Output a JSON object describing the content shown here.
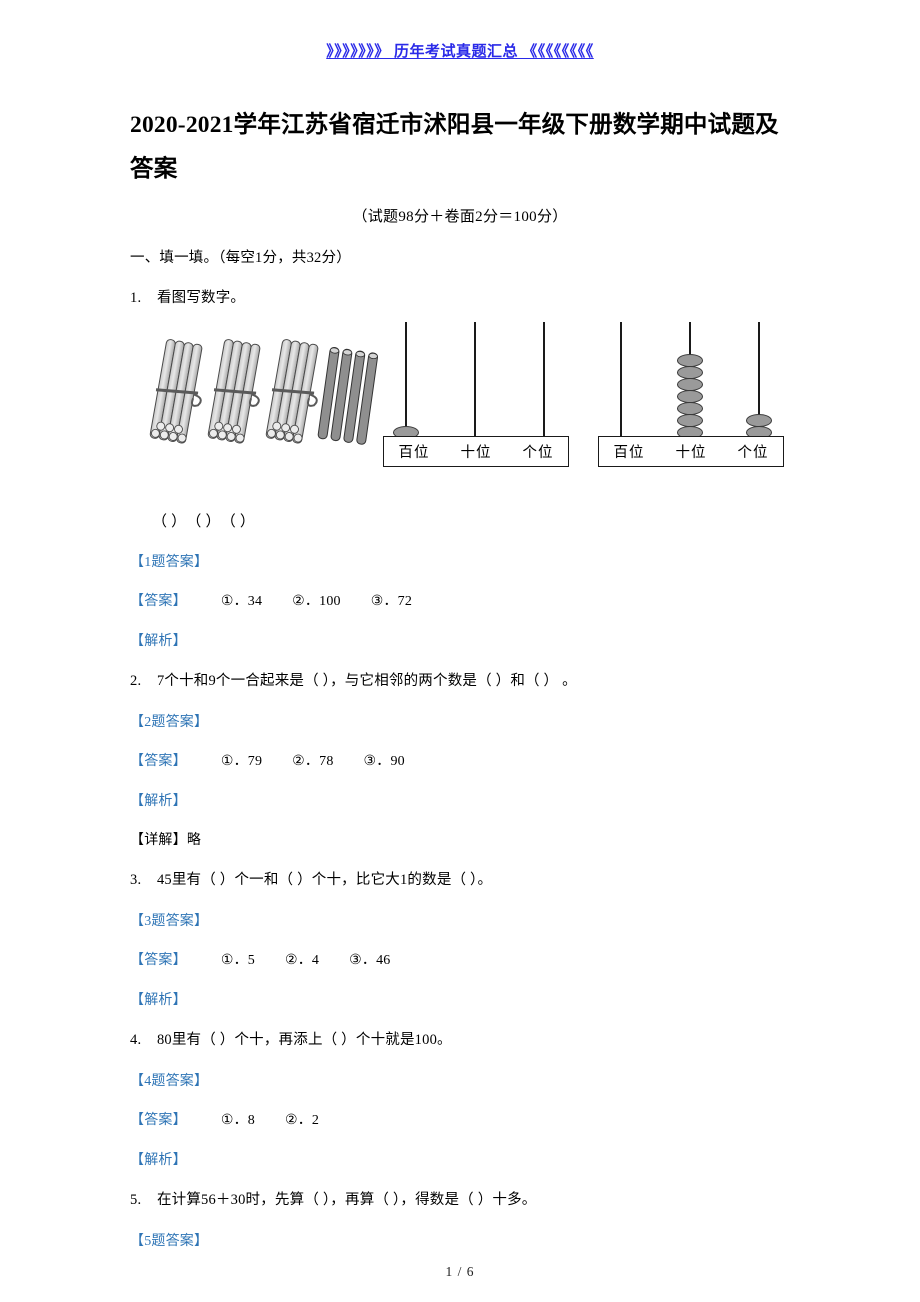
{
  "header": {
    "banner_text": "》》》》》》》 历年考试真题汇总 《《《《《《《《"
  },
  "document": {
    "title": "2020-2021学年江苏省宿迁市沭阳县一年级下册数学期中试题及答案",
    "subtitle": "（试题98分＋卷面2分＝100分）",
    "section_heading": "一、填一填。（每空1分，共32分）"
  },
  "questions": [
    {
      "number": "1.",
      "text": "看图写数字。",
      "answer_header": "【1题答案】",
      "answer_tag": "【答案】",
      "answers": [
        "①．34",
        "②．100",
        "③．72"
      ],
      "analysis_tag": "【解析】"
    },
    {
      "number": "2.",
      "text": "7个十和9个一合起来是（        ），与它相邻的两个数是（        ）和（        ） 。",
      "answer_header": "【2题答案】",
      "answer_tag": "【答案】",
      "answers": [
        "①．79",
        "②．78",
        "③．90"
      ],
      "analysis_tag": "【解析】",
      "detail_tag": "【详解】",
      "detail_text": "略"
    },
    {
      "number": "3.",
      "text": "45里有（        ）个一和（        ）个十，比它大1的数是（        ）。",
      "answer_header": "【3题答案】",
      "answer_tag": "【答案】",
      "answers": [
        "①．5",
        "②．4",
        "③．46"
      ],
      "analysis_tag": "【解析】"
    },
    {
      "number": "4.",
      "text": "80里有（        ）个十，再添上（        ）个十就是100。",
      "answer_header": "【4题答案】",
      "answer_tag": "【答案】",
      "answers": [
        "①．8",
        "②．2"
      ],
      "analysis_tag": "【解析】"
    },
    {
      "number": "5.",
      "text": "在计算56＋30时，先算（        ），再算（        ），得数是（        ）十多。",
      "answer_header": "【5题答案】"
    }
  ],
  "figure": {
    "blanks_row": [
      "（        ）",
      "（        ）",
      "（        ）"
    ],
    "sticks": {
      "bundles": 3,
      "loose_sticks": 4,
      "represented_value": "34"
    },
    "abacus_left": {
      "columns": [
        "百位",
        "十位",
        "个位"
      ],
      "beads": [
        1,
        0,
        0
      ],
      "represented_value": "100"
    },
    "abacus_right": {
      "columns": [
        "百位",
        "十位",
        "个位"
      ],
      "beads": [
        0,
        7,
        2
      ],
      "represented_value": "72"
    }
  },
  "footer": {
    "page_number": "1 / 6"
  },
  "colors": {
    "answer_blue": "#2E74B5",
    "link_blue": "#2a2ae8",
    "bead_gray": "#9a9a9a",
    "text_black": "#000000"
  }
}
